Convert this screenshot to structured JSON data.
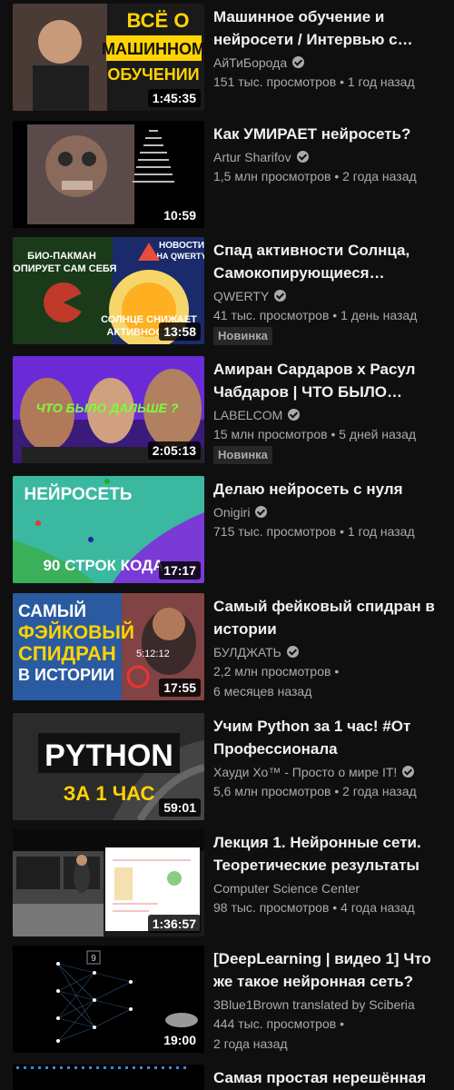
{
  "videos": [
    {
      "title": "Машинное обучение и нейросети / Интервью с…",
      "channel": "АйТиБорода",
      "verified": true,
      "stats": "151 тыс. просмотров • 1 год назад",
      "duration": "1:45:35",
      "thumb_text": [
        "ВСЁ О",
        "МАШИННОМ",
        "ОБУЧЕНИИ"
      ]
    },
    {
      "title": "Как УМИРАЕТ нейросеть?",
      "channel": "Artur Sharifov",
      "verified": true,
      "stats": "1,5 млн просмотров • 2 года назад",
      "duration": "10:59"
    },
    {
      "title": "Спад активности Солнца, Самокопирующиеся…",
      "channel": "QWERTY",
      "verified": true,
      "stats": "41 тыс. просмотров • 1 день назад",
      "duration": "13:58",
      "badge": "Новинка",
      "thumb_text": [
        "БИО-ПАКМАН",
        "КОПИРУЕТ САМ СЕБЯ",
        "НОВОСТИ",
        "НА QWERTY",
        "СОЛНЦЕ СНИЖАЕТ",
        "АКТИВНОСТЬ?"
      ]
    },
    {
      "title": "Амиран Сардаров x Расул Чабдаров | ЧТО БЫЛО…",
      "channel": "LABELCOM",
      "verified": true,
      "stats": "15 млн просмотров • 5 дней назад",
      "duration": "2:05:13",
      "badge": "Новинка",
      "thumb_text": [
        "ЧТО БЫЛО ДАЛЬШЕ ?"
      ]
    },
    {
      "title": "Делаю нейросеть с нуля",
      "channel": "Onigiri",
      "verified": true,
      "stats": "715 тыс. просмотров • 1 год назад",
      "duration": "17:17",
      "thumb_text": [
        "НЕЙРОСЕТЬ",
        "90 СТРОК КОДА"
      ]
    },
    {
      "title": "Самый фейковый спидран в истории",
      "channel": "БУЛДЖАТЬ",
      "verified": true,
      "stats": "2,2 млн просмотров •",
      "stats2": "6 месяцев назад",
      "duration": "17:55",
      "thumb_text": [
        "САМЫЙ",
        "ФЭЙКОВЫЙ",
        "СПИДРАН",
        "В ИСТОРИИ",
        "5:12:12"
      ]
    },
    {
      "title": "Учим Python за 1 час! #От Профессионала",
      "channel": "Хауди Хо™ - Просто о мире IT!",
      "verified": true,
      "stats": "5,6 млн просмотров • 2 года назад",
      "duration": "59:01",
      "thumb_text": [
        "PYTHON",
        "ЗА 1 ЧАС"
      ]
    },
    {
      "title": "Лекция 1. Нейронные сети. Теоретические результаты",
      "channel": "Computer Science Center",
      "verified": false,
      "stats": "98 тыс. просмотров • 4 года назад",
      "duration": "1:36:57"
    },
    {
      "title": "[DeepLearning | видео 1] Что же такое нейронная сеть?",
      "channel": "3Blue1Brown translated by Sciberia",
      "verified": false,
      "stats": "444 тыс. просмотров •",
      "stats2": "2 года назад",
      "duration": "19:00",
      "thumb_text": [
        "9"
      ]
    },
    {
      "title": "Самая простая нерешённая",
      "channel": "",
      "verified": false,
      "stats": "",
      "duration": ""
    }
  ]
}
